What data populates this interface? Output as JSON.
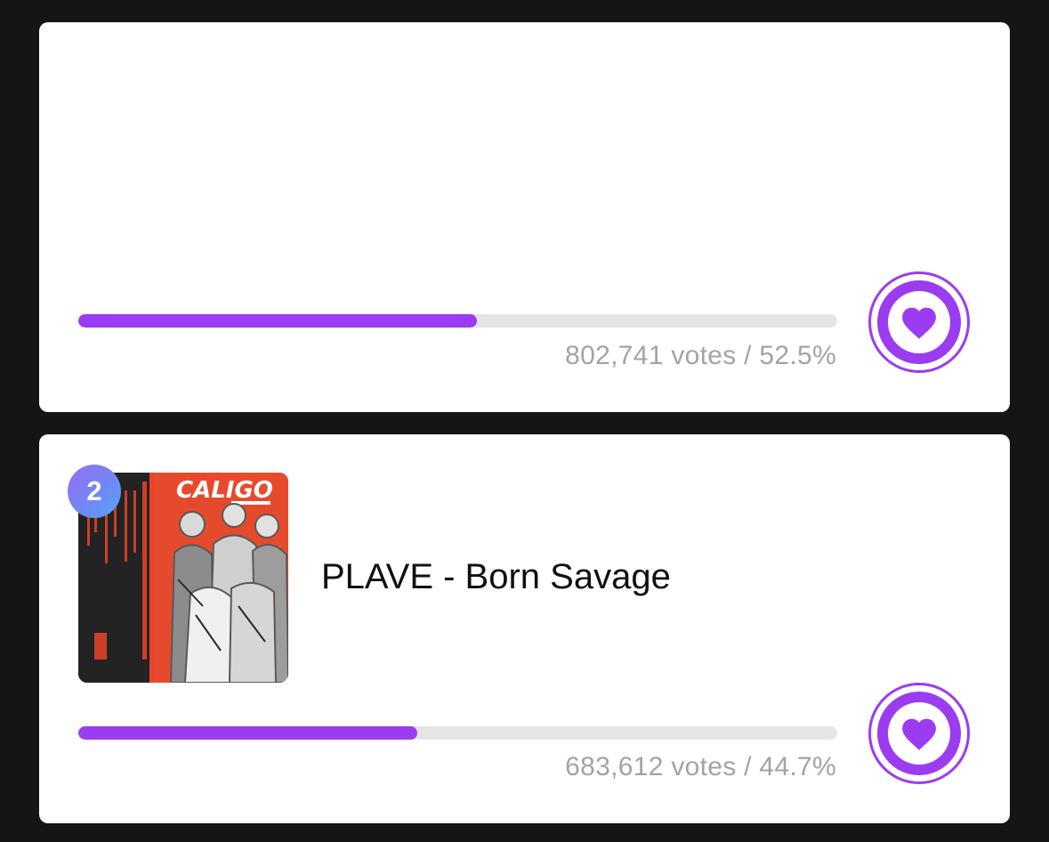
{
  "entries": [
    {
      "title": "",
      "votes_text": "802,741 votes / 52.5%",
      "percent": 52.5
    },
    {
      "rank": "2",
      "title": "PLAVE - Born Savage",
      "album_text": "CALIGO",
      "votes_text": "683,612 votes / 44.7%",
      "percent": 44.7
    }
  ],
  "colors": {
    "accent": "#9b3cf0",
    "track": "#e5e5e5",
    "muted_text": "#a3a3a3",
    "background": "#151515"
  },
  "icons": {
    "vote": "heart-icon"
  }
}
